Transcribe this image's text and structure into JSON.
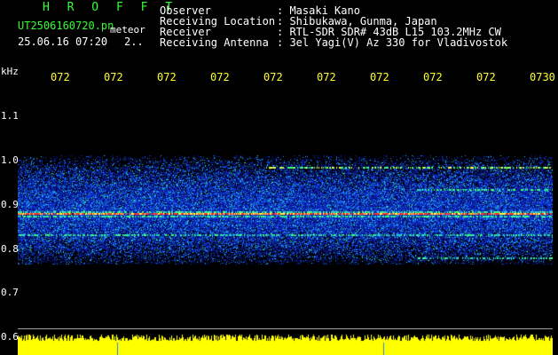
{
  "header": {
    "title": "H R O F F T",
    "filename": "UT2506160720.pn",
    "meteor_label": "meteor",
    "datetime": "25.06.16 07:20",
    "trailing": "2..",
    "observer_label": "Observer",
    "observer": ": Masaki Kano",
    "location_label": "Receiving Location",
    "location": ": Shibukawa, Gunma, Japan",
    "receiver_label": "Receiver",
    "receiver": ": RTL-SDR SDR# 43dB L15 103.2MHz CW",
    "antenna_label": "Receiving Antenna",
    "antenna": ": 3el Yagi(V) Az 330 for Vladivostok"
  },
  "axis": {
    "y_unit": "kHz",
    "y_ticks": [
      "1.1",
      "1.0",
      "0.9",
      "0.8",
      "0.7",
      "0.6"
    ],
    "x_ticks": [
      "072",
      "072",
      "072",
      "072",
      "072",
      "072",
      "072",
      "072",
      "072",
      "0730"
    ]
  },
  "colors": {
    "background": "#000000",
    "header_green": "#33ff33",
    "time_yellow": "#ffff33",
    "level_yellow": "#ffff00"
  }
}
